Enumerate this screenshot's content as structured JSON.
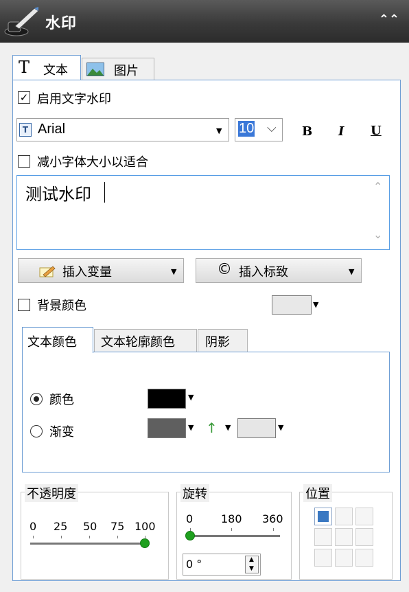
{
  "header": {
    "title": "水印",
    "collapse_icon": "double-chevron-up"
  },
  "tabs": [
    {
      "label": "文本",
      "icon": "T"
    },
    {
      "label": "图片",
      "icon": "picture-icon"
    }
  ],
  "enable_text_watermark": {
    "label": "启用文字水印",
    "checked": true
  },
  "font": {
    "family": "Arial",
    "size": "10",
    "bold": "B",
    "italic": "I",
    "underline": "U"
  },
  "shrink_to_fit": {
    "label": "减小字体大小以适合",
    "checked": false
  },
  "watermark_text": "测试水印",
  "insert_variable_label": "插入变量",
  "insert_mark": {
    "symbol": "©",
    "label": "插入标致"
  },
  "background_color": {
    "label": "背景颜色",
    "checked": false,
    "color": "#e8e8e8"
  },
  "color_tabs": [
    "文本颜色",
    "文本轮廓颜色",
    "阴影"
  ],
  "color_option": {
    "label": "颜色",
    "selected": true,
    "color": "#000000"
  },
  "gradient_option": {
    "label": "渐变",
    "selected": false,
    "color_start": "#5f5f5f",
    "color_end": "#e6e6e6",
    "direction_arrow": "↑"
  },
  "opacity": {
    "label": "不透明度",
    "ticks": [
      "0",
      "25",
      "50",
      "75",
      "100"
    ],
    "value": 100,
    "min": 0,
    "max": 100
  },
  "rotation": {
    "label": "旋转",
    "ticks": [
      "0",
      "180",
      "360"
    ],
    "value": 0,
    "min": 0,
    "max": 360,
    "input_value": "0 °"
  },
  "position": {
    "label": "位置",
    "selected_index": 0
  },
  "colors": {
    "accent": "#6d9dd4",
    "slider_thumb": "#1fa01f"
  }
}
